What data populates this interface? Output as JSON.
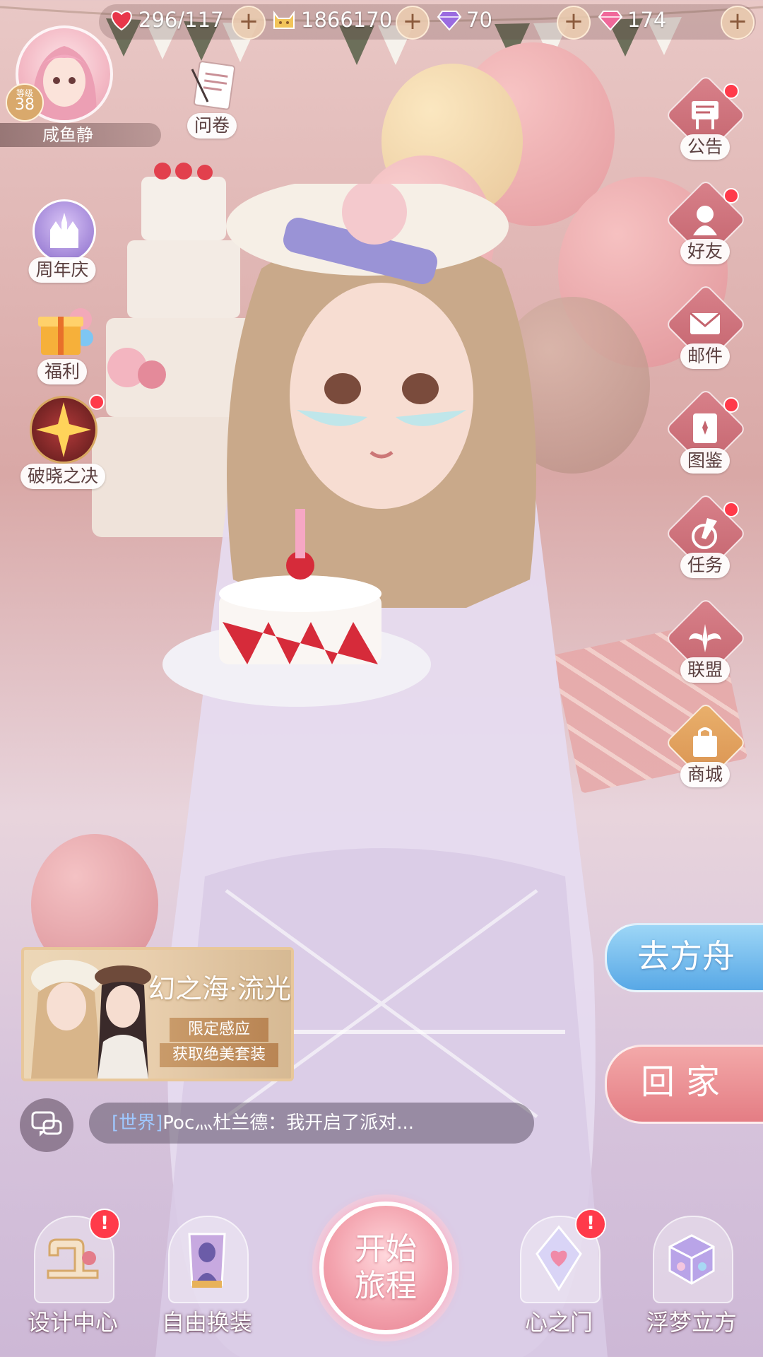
{
  "resources": [
    {
      "icon": "heart-icon",
      "value": "296/117"
    },
    {
      "icon": "cat-coin-icon",
      "value": "1866170"
    },
    {
      "icon": "purple-diamond-icon",
      "value": "70"
    },
    {
      "icon": "pink-diamond-icon",
      "value": "174"
    }
  ],
  "player": {
    "level_label": "等级",
    "level": "38",
    "nickname": "咸鱼静"
  },
  "survey_label": "问卷",
  "left_menu": [
    {
      "key": "anniversary",
      "label": "周年庆",
      "icon": "castle-icon"
    },
    {
      "key": "welfare",
      "label": "福利",
      "icon": "gift-box-icon"
    },
    {
      "key": "dawn",
      "label": "破晓之决",
      "icon": "compass-star-icon",
      "badge": true
    }
  ],
  "right_menu": [
    {
      "key": "notice",
      "label": "公告",
      "icon": "notice-board-icon",
      "badge": true
    },
    {
      "key": "friends",
      "label": "好友",
      "icon": "friend-icon",
      "badge": true
    },
    {
      "key": "mail",
      "label": "邮件",
      "icon": "mail-icon"
    },
    {
      "key": "gallery",
      "label": "图鉴",
      "icon": "card-book-icon",
      "badge": true
    },
    {
      "key": "tasks",
      "label": "任务",
      "icon": "task-quill-icon",
      "badge": true
    },
    {
      "key": "alliance",
      "label": "联盟",
      "icon": "alliance-wings-icon"
    },
    {
      "key": "shop",
      "label": "商城",
      "icon": "shopping-bag-icon"
    }
  ],
  "banners": {
    "ark": "去方舟",
    "home": "回家"
  },
  "event": {
    "title": "幻之海·流光",
    "tag": "限定感应",
    "subtitle": "获取绝美套装"
  },
  "chat": {
    "channel": "[世界]",
    "message": "Poc灬杜兰德：我开启了派对..."
  },
  "bottom_nav": [
    {
      "key": "design",
      "label": "设计中心",
      "icon": "sewing-machine-icon",
      "alert": "!"
    },
    {
      "key": "wardrobe",
      "label": "自由换装",
      "icon": "dress-mirror-icon"
    },
    {
      "key": "heart_door",
      "label": "心之门",
      "icon": "heart-crystal-icon",
      "alert": "!"
    },
    {
      "key": "dream_cube",
      "label": "浮梦立方",
      "icon": "dream-cube-icon"
    }
  ],
  "start_button": {
    "line1": "开始",
    "line2": "旅程"
  },
  "colors": {
    "accent_pink": "#e78392",
    "badge_red": "#ff3a4a",
    "ark_blue": "#58a8e6",
    "gold": "#d9a96c"
  }
}
